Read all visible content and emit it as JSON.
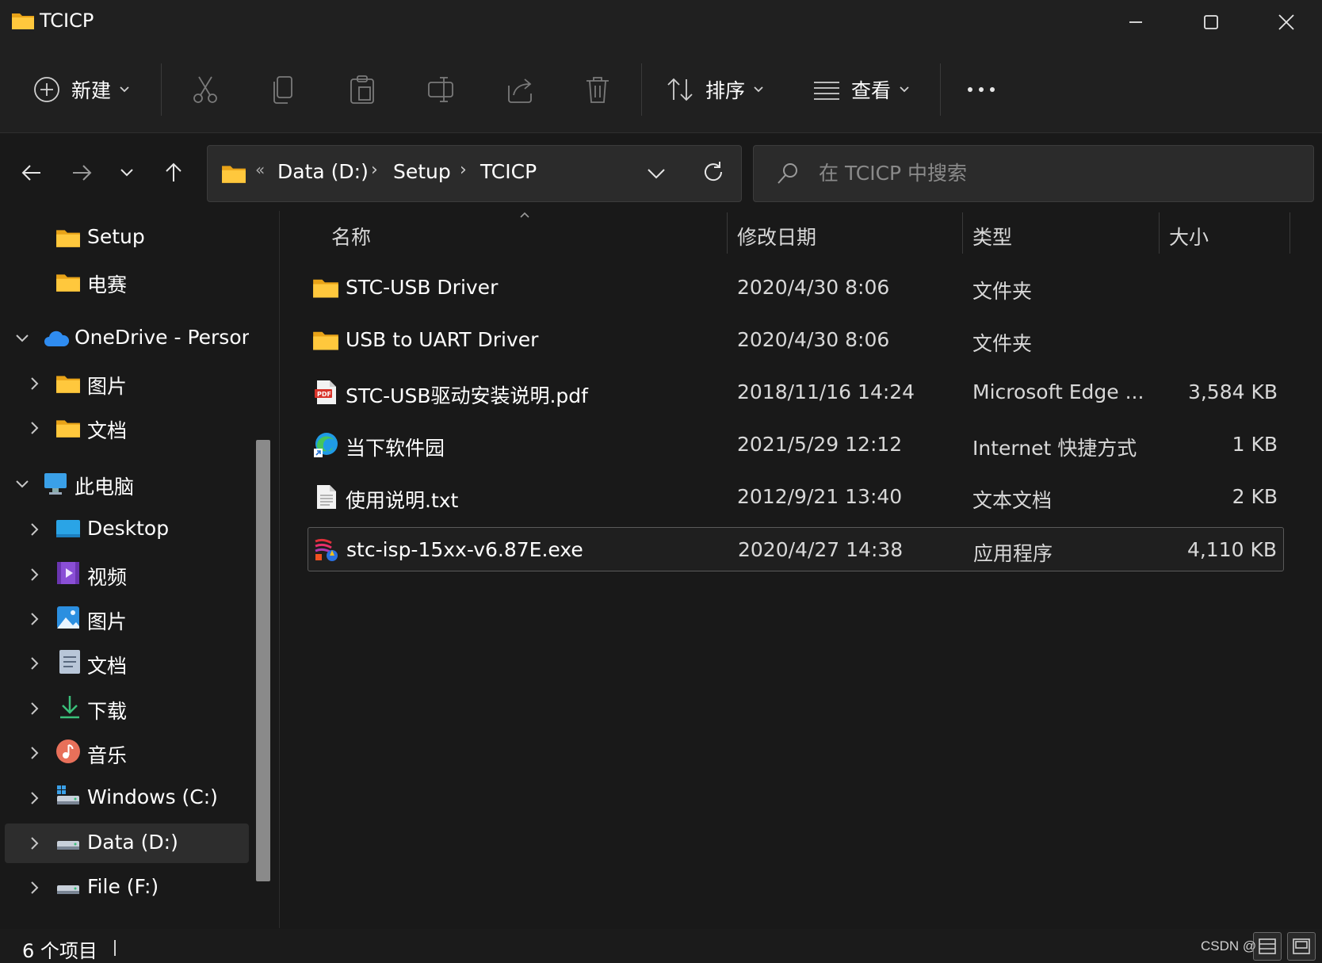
{
  "window": {
    "title": "TCICP"
  },
  "commandbar": {
    "new_label": "新建",
    "sort_label": "排序",
    "view_label": "查看"
  },
  "address": {
    "overflow": "«",
    "crumbs": [
      "Data (D:)",
      "Setup",
      "TCICP"
    ]
  },
  "search": {
    "placeholder": "在 TCICP 中搜索"
  },
  "sidebar": {
    "items": [
      {
        "label": "Setup",
        "icon": "folder-icon"
      },
      {
        "label": "电赛",
        "icon": "folder-icon"
      },
      {
        "label": "OneDrive - Persona",
        "icon": "onedrive-icon"
      },
      {
        "label": "图片",
        "icon": "folder-icon"
      },
      {
        "label": "文档",
        "icon": "folder-icon"
      },
      {
        "label": "此电脑",
        "icon": "computer-icon"
      },
      {
        "label": "Desktop",
        "icon": "desktop-icon"
      },
      {
        "label": "视频",
        "icon": "videos-icon"
      },
      {
        "label": "图片",
        "icon": "pictures-icon"
      },
      {
        "label": "文档",
        "icon": "documents-icon"
      },
      {
        "label": "下载",
        "icon": "downloads-icon"
      },
      {
        "label": "音乐",
        "icon": "music-icon"
      },
      {
        "label": "Windows (C:)",
        "icon": "drive-c-icon"
      },
      {
        "label": "Data (D:)",
        "icon": "drive-icon"
      },
      {
        "label": "File (F:)",
        "icon": "drive-icon"
      }
    ],
    "selected": "Data (D:)"
  },
  "columns": {
    "name": "名称",
    "date": "修改日期",
    "type": "类型",
    "size": "大小"
  },
  "files": [
    {
      "name": "STC-USB Driver",
      "date": "2020/4/30 8:06",
      "type": "文件夹",
      "size": "",
      "icon": "folder-icon"
    },
    {
      "name": "USB to UART Driver",
      "date": "2020/4/30 8:06",
      "type": "文件夹",
      "size": "",
      "icon": "folder-icon"
    },
    {
      "name": "STC-USB驱动安装说明.pdf",
      "date": "2018/11/16 14:24",
      "type": "Microsoft Edge ...",
      "size": "3,584 KB",
      "icon": "pdf-icon"
    },
    {
      "name": "当下软件园",
      "date": "2021/5/29 12:12",
      "type": "Internet 快捷方式",
      "size": "1 KB",
      "icon": "edge-shortcut-icon"
    },
    {
      "name": "使用说明.txt",
      "date": "2012/9/21 13:40",
      "type": "文本文档",
      "size": "2 KB",
      "icon": "text-file-icon"
    },
    {
      "name": "stc-isp-15xx-v6.87E.exe",
      "date": "2020/4/27 14:38",
      "type": "应用程序",
      "size": "4,110 KB",
      "icon": "exe-icon"
    }
  ],
  "selected_file": "stc-isp-15xx-v6.87E.exe",
  "status": {
    "count": "6 个项目"
  },
  "watermark": "CSDN @"
}
